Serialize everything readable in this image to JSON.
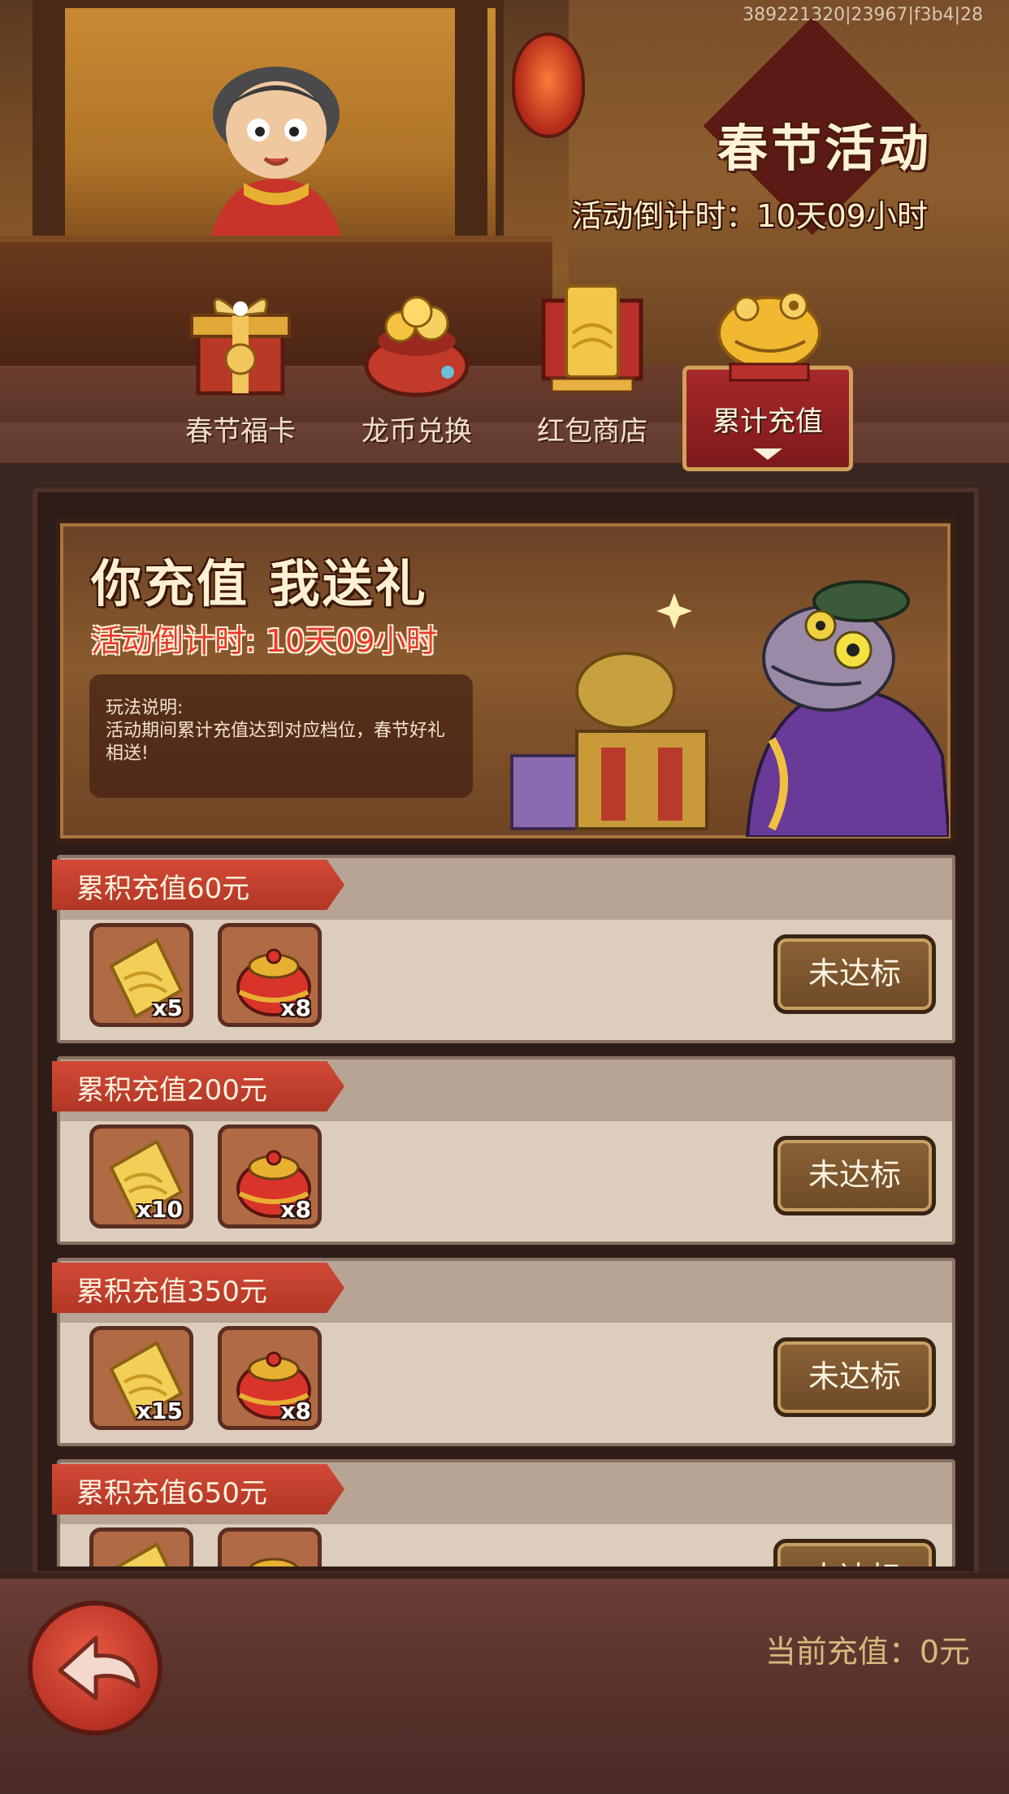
{
  "debug_id": "389221320|23967|f3b4|28",
  "header": {
    "title": "春节活动",
    "countdown": "活动倒计时：10天09小时"
  },
  "tabs": [
    {
      "label": "春节福卡",
      "icon": "gift-box-icon",
      "active": false
    },
    {
      "label": "龙币兑换",
      "icon": "gold-ingot-bag-icon",
      "active": false
    },
    {
      "label": "红包商店",
      "icon": "red-envelope-icon",
      "active": false
    },
    {
      "label": "累计充值",
      "icon": "golden-toad-icon",
      "active": true
    }
  ],
  "banner": {
    "title": "你充值 我送礼",
    "countdown": "活动倒计时: 10天09小时",
    "rules_title": "玩法说明:",
    "rules_text": "活动期间累计充值达到对应档位，春节好礼相送!"
  },
  "tiers": [
    {
      "label": "累积充值60元",
      "items": [
        {
          "icon": "gold-envelope-icon",
          "count": "x5"
        },
        {
          "icon": "red-pot-icon",
          "count": "x8"
        }
      ],
      "status": "未达标"
    },
    {
      "label": "累积充值200元",
      "items": [
        {
          "icon": "gold-envelope-icon",
          "count": "x10"
        },
        {
          "icon": "red-pot-icon",
          "count": "x8"
        }
      ],
      "status": "未达标"
    },
    {
      "label": "累积充值350元",
      "items": [
        {
          "icon": "gold-envelope-icon",
          "count": "x15"
        },
        {
          "icon": "red-pot-icon",
          "count": "x8"
        }
      ],
      "status": "未达标"
    },
    {
      "label": "累积充值650元",
      "items": [
        {
          "icon": "gold-envelope-icon",
          "count": ""
        },
        {
          "icon": "red-pot-icon",
          "count": ""
        }
      ],
      "status": "未达标"
    }
  ],
  "footer": {
    "back_icon": "back-arrow-icon",
    "current_charge": "当前充值：0元"
  }
}
